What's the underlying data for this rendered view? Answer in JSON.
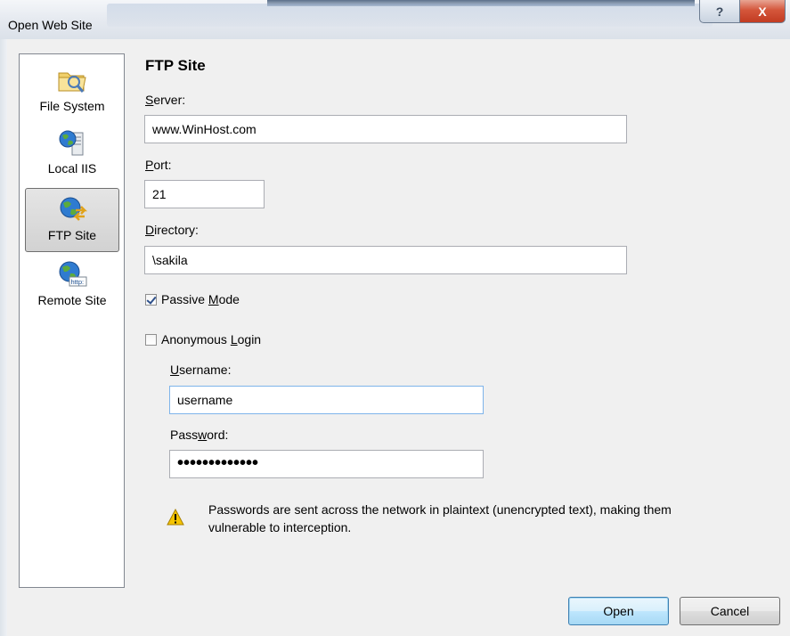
{
  "window": {
    "title": "Open Web Site",
    "help_glyph": "?",
    "close_glyph": "X"
  },
  "sidebar": {
    "items": [
      {
        "label": "File System",
        "icon": "folder-icon",
        "selected": false
      },
      {
        "label": "Local IIS",
        "icon": "local-iis-icon",
        "selected": false
      },
      {
        "label": "FTP Site",
        "icon": "ftp-globe-icon",
        "selected": true
      },
      {
        "label": "Remote Site",
        "icon": "http-globe-icon",
        "selected": false
      }
    ]
  },
  "form": {
    "heading": "FTP Site",
    "server": {
      "label_key": "S",
      "label_rest": "erver:",
      "value": "www.WinHost.com"
    },
    "port": {
      "label_key": "P",
      "label_rest": "ort:",
      "value": "21"
    },
    "directory": {
      "label_key": "D",
      "label_rest": "irectory:",
      "value": "\\sakila"
    },
    "passive_mode": {
      "label_pre": "Passive ",
      "label_key": "M",
      "label_rest": "ode",
      "checked": true
    },
    "anonymous_login": {
      "label_pre": "Anonymous ",
      "label_key": "L",
      "label_rest": "ogin",
      "checked": false
    },
    "username": {
      "label_key": "U",
      "label_rest": "sername:",
      "value": "username"
    },
    "password": {
      "label_pre": "Pass",
      "label_key": "w",
      "label_rest": "ord:",
      "value": "•••••••••••••"
    },
    "warning_line1": "Passwords are sent across the network in plaintext (unencrypted text), making them",
    "warning_line2": "vulnerable to interception."
  },
  "buttons": {
    "open": "Open",
    "cancel": "Cancel"
  },
  "colors": {
    "accent": "#3c7fb1",
    "close_red": "#c23c22",
    "warning_yellow": "#f5c400"
  }
}
